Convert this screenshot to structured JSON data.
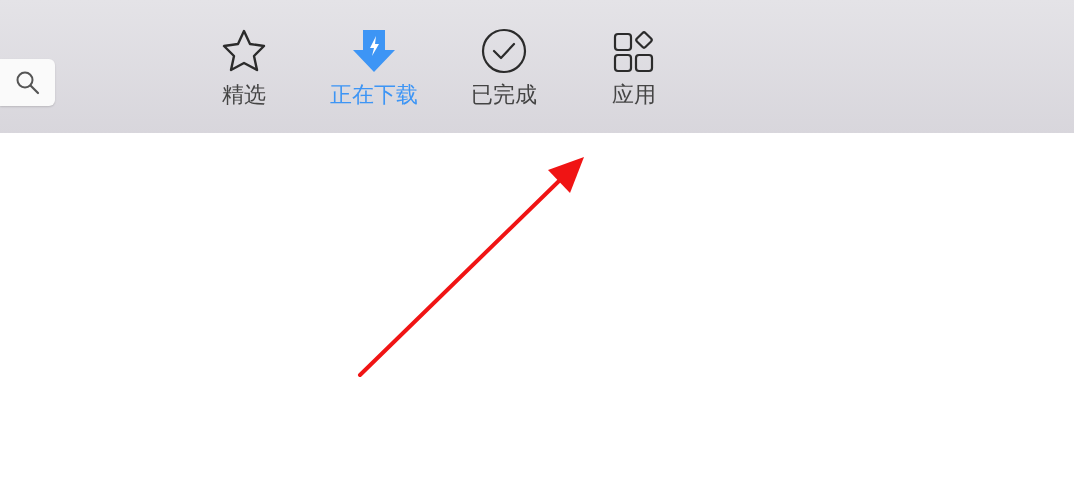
{
  "toolbar": {
    "tabs": [
      {
        "label": "精选",
        "kind": "star",
        "selected": false
      },
      {
        "label": "正在下载",
        "kind": "download",
        "selected": true
      },
      {
        "label": "已完成",
        "kind": "check",
        "selected": false
      },
      {
        "label": "应用",
        "kind": "apps",
        "selected": false
      }
    ]
  }
}
